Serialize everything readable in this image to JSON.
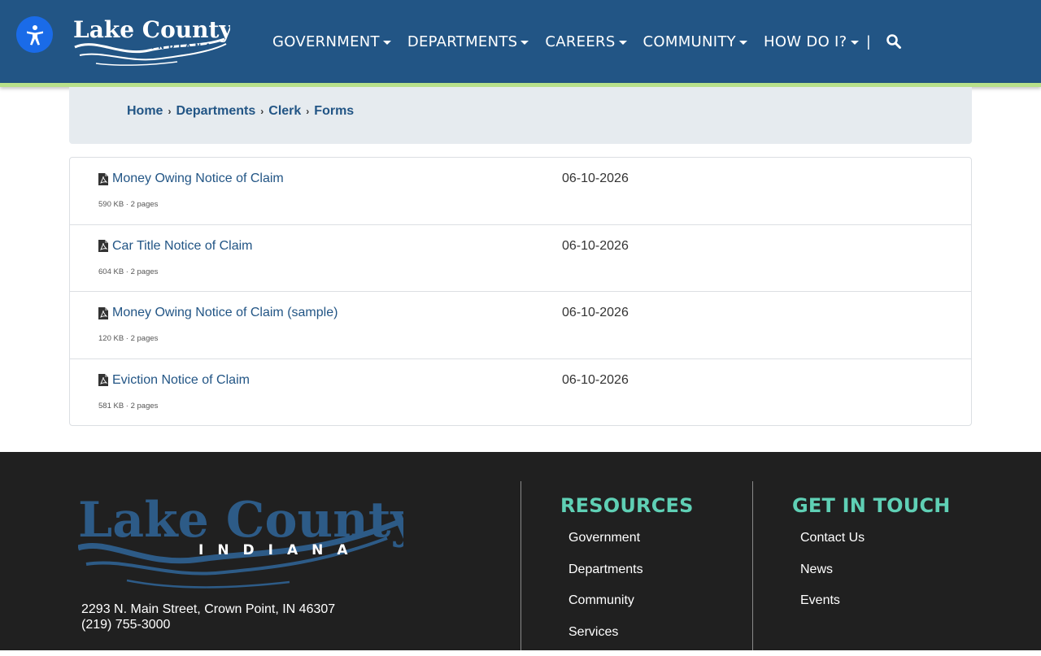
{
  "header": {
    "logo_text": "Lake County",
    "logo_sub": "INDIANA",
    "nav": [
      {
        "label": "GOVERNMENT"
      },
      {
        "label": "DEPARTMENTS"
      },
      {
        "label": "CAREERS"
      },
      {
        "label": "COMMUNITY"
      },
      {
        "label": "HOW DO I?"
      }
    ],
    "nav_divider": "|",
    "icons": {
      "accessibility": "accessibility-icon",
      "search": "search-icon"
    }
  },
  "breadcrumb": {
    "items": [
      "Home",
      "Departments",
      "Clerk",
      "Forms"
    ],
    "separator": "›"
  },
  "forms": [
    {
      "title": "Money Owing Notice of Claim",
      "meta": "590 KB · 2 pages",
      "date": "06-10-2026"
    },
    {
      "title": "Car Title Notice of Claim",
      "meta": "604 KB · 2 pages",
      "date": "06-10-2026"
    },
    {
      "title": "Money Owing Notice of Claim (sample)",
      "meta": "120 KB · 2 pages",
      "date": "06-10-2026"
    },
    {
      "title": "Eviction Notice of Claim",
      "meta": "581 KB · 2 pages",
      "date": "06-10-2026"
    }
  ],
  "footer": {
    "logo_text": "Lake County",
    "logo_sub": "INDIANA",
    "address_line1": "2293 N. Main Street, Crown Point, IN 46307",
    "address_line2": "(219) 755-3000",
    "resources": {
      "heading": "RESOURCES",
      "links": [
        "Government",
        "Departments",
        "Community",
        "Services"
      ]
    },
    "contact": {
      "heading": "GET IN TOUCH",
      "links": [
        "Contact Us",
        "News",
        "Events"
      ]
    }
  },
  "colors": {
    "header_bg": "#225585",
    "accent_green": "#b8e08a",
    "footer_bg": "#202020",
    "footer_heading": "#5fd0b5",
    "link": "#225585"
  }
}
